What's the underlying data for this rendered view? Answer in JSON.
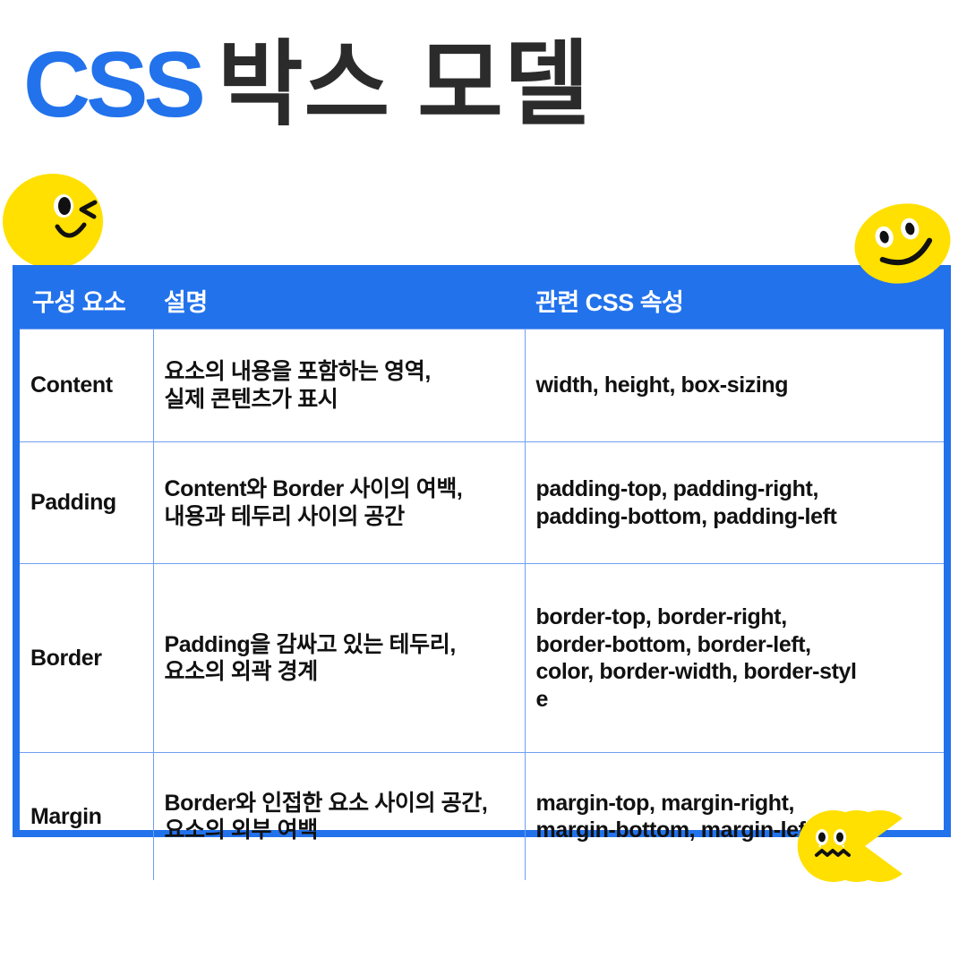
{
  "header": {
    "title_accent": "CSS",
    "title_rest": "박스 모델"
  },
  "colors": {
    "brand_blue": "#2272ec",
    "grid_blue": "#6f9ff1",
    "sticker_yellow": "#ffe000",
    "title_dark": "#2b2b2b",
    "page_background": "#ffffff"
  },
  "stickers": [
    {
      "name": "winking-smiley",
      "expression": "wink"
    },
    {
      "name": "smiling-face",
      "expression": "smile"
    },
    {
      "name": "pacman-trio-face",
      "expression": "wavy-mouth"
    }
  ],
  "table": {
    "columns": [
      "구성 요소",
      "설명",
      "관련 CSS 속성"
    ],
    "rows": [
      {
        "name": "Content",
        "description_lines": [
          "요소의 내용을 포함하는 영역,",
          "실제 콘텐츠가 표시"
        ],
        "properties_lines": [
          "width, height, box-sizing"
        ]
      },
      {
        "name": "Padding",
        "description_lines": [
          "Content와 Border 사이의 여백,",
          "내용과 테두리 사이의 공간"
        ],
        "properties_lines": [
          "padding-top, padding-right,",
          "padding-bottom, padding-left"
        ]
      },
      {
        "name": "Border",
        "description_lines": [
          "Padding을 감싸고 있는 테두리,",
          "요소의 외곽 경계"
        ],
        "properties_lines": [
          "border-top, border-right,",
          "border-bottom, border-left,",
          "color, border-width, border-styl",
          "e"
        ]
      },
      {
        "name": "Margin",
        "description_lines": [
          "Border와 인접한 요소 사이의 공간,",
          "요소의 외부 여백"
        ],
        "properties_lines": [
          "margin-top, margin-right,",
          "margin-bottom, margin-left"
        ]
      }
    ]
  }
}
